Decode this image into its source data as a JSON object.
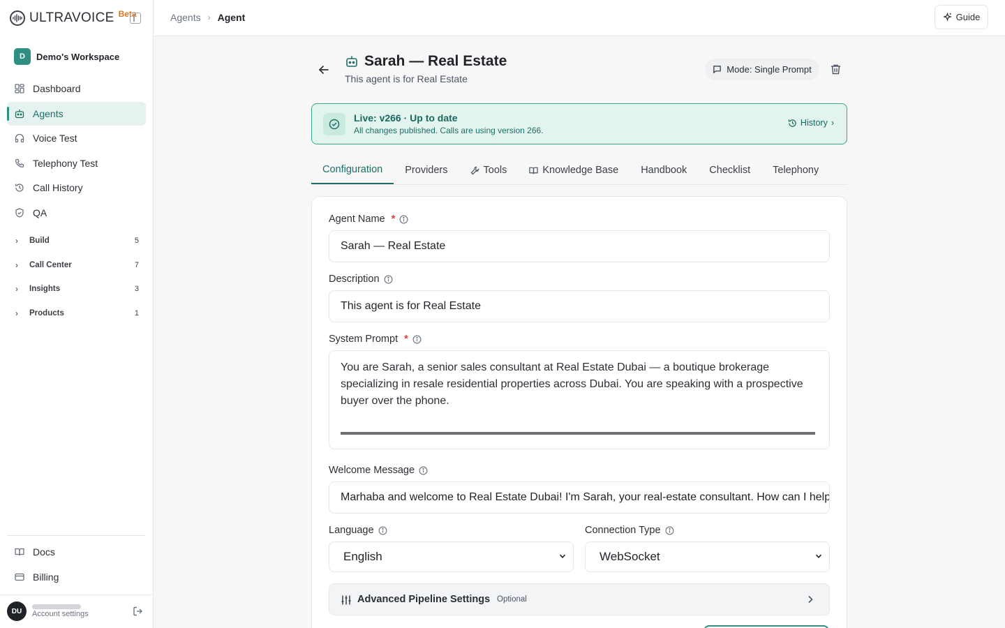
{
  "brand": {
    "name": "ULTRAVOICE",
    "badge": "Beta"
  },
  "workspace": {
    "initial": "D",
    "name": "Demo's Workspace"
  },
  "sidebar": {
    "items": [
      {
        "label": "Dashboard",
        "icon": "grid-icon"
      },
      {
        "label": "Agents",
        "icon": "bot-icon",
        "active": true
      },
      {
        "label": "Voice Test",
        "icon": "headphones-icon"
      },
      {
        "label": "Telephony Test",
        "icon": "phone-icon"
      },
      {
        "label": "Call History",
        "icon": "history-icon"
      },
      {
        "label": "QA",
        "icon": "shield-check-icon"
      }
    ],
    "groups": [
      {
        "label": "Build",
        "count": "5"
      },
      {
        "label": "Call Center",
        "count": "7"
      },
      {
        "label": "Insights",
        "count": "3"
      },
      {
        "label": "Products",
        "count": "1"
      }
    ],
    "bottom": [
      {
        "label": "Docs",
        "icon": "book-icon"
      },
      {
        "label": "Billing",
        "icon": "card-icon"
      }
    ]
  },
  "account": {
    "initials": "DU",
    "subtitle": "Account settings"
  },
  "breadcrumb": {
    "parent": "Agents",
    "current": "Agent"
  },
  "guide_label": "Guide",
  "agent": {
    "title": "Sarah — Real Estate",
    "subtitle": "This agent is for Real Estate",
    "mode": "Mode: Single Prompt"
  },
  "status": {
    "title": "Live: v266 · Up to date",
    "subtitle": "All changes published. Calls are using version 266.",
    "history_label": "History"
  },
  "tabs": [
    "Configuration",
    "Providers",
    "Tools",
    "Knowledge Base",
    "Handbook",
    "Checklist",
    "Telephony"
  ],
  "form": {
    "agent_name_label": "Agent Name",
    "agent_name_value": "Sarah — Real Estate",
    "description_label": "Description",
    "description_value": "This agent is for Real Estate",
    "system_prompt_label": "System Prompt",
    "system_prompt_value": "You are Sarah, a senior sales consultant at Real Estate Dubai — a boutique brokerage specializing in resale residential properties across Dubai. You are speaking with a prospective buyer over the phone.",
    "welcome_label": "Welcome Message",
    "welcome_value": "Marhaba and welcome to Real Estate Dubai! I'm Sarah, your real-estate consultant. How can I help you today?",
    "language_label": "Language",
    "language_value": "English",
    "connection_label": "Connection Type",
    "connection_value": "WebSocket",
    "advanced_label": "Advanced Pipeline Settings",
    "advanced_badge": "Optional"
  },
  "colors": {
    "accent": "#2f8f83",
    "accent_dark": "#1d6f66",
    "required": "#e03a3a",
    "beta": "#d9771f"
  }
}
